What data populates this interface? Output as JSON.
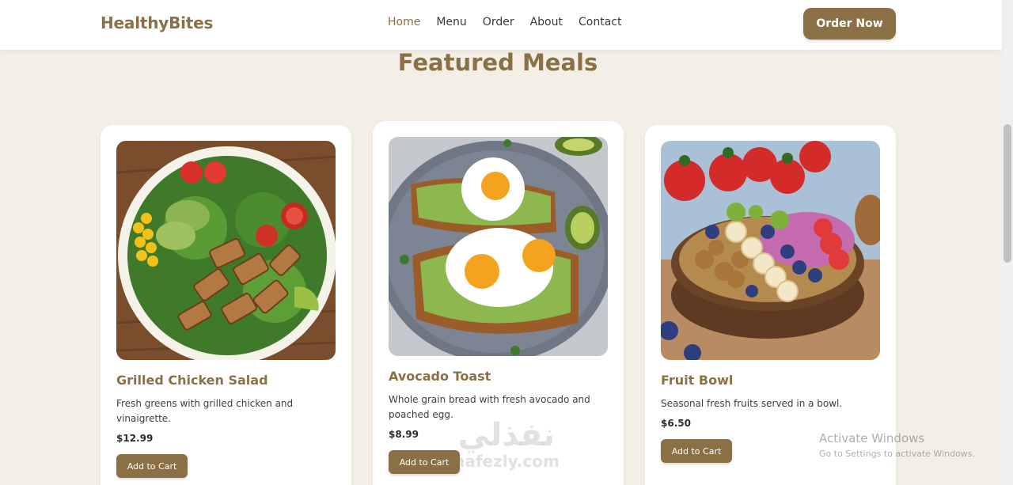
{
  "header": {
    "logo": "HealthyBites",
    "nav": [
      "Home",
      "Menu",
      "Order",
      "About",
      "Contact"
    ],
    "active_nav": "Home",
    "cta": "Order Now"
  },
  "section": {
    "title": "Featured Meals"
  },
  "meals": [
    {
      "title": "Grilled Chicken Salad",
      "description": "Fresh greens with grilled chicken and vinaigrette.",
      "price": "$12.99",
      "button": "Add to Cart"
    },
    {
      "title": "Avocado Toast",
      "description": "Whole grain bread with fresh avocado and poached egg.",
      "price": "$8.99",
      "button": "Add to Cart"
    },
    {
      "title": "Fruit Bowl",
      "description": "Seasonal fresh fruits served in a bowl.",
      "price": "$6.50",
      "button": "Add to Cart"
    }
  ],
  "watermarks": {
    "windows_title": "Activate Windows",
    "windows_sub": "Go to Settings to activate Windows.",
    "site_arabic": "نفذلي",
    "site_latin": "nafezly.com"
  },
  "colors": {
    "accent": "#8b7045",
    "background": "#f3efe7",
    "card": "#ffffff"
  }
}
